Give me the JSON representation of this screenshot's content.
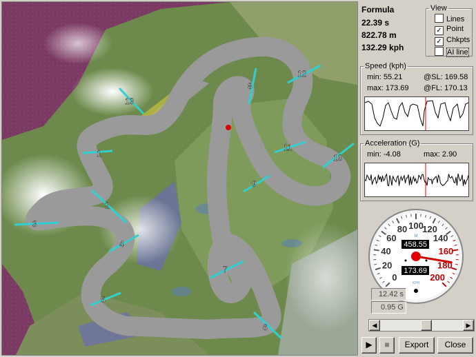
{
  "race": {
    "car": "Formula",
    "time": "22.39 s",
    "distance": "822.78 m",
    "speed": "132.29 kph"
  },
  "view": {
    "legend": "View",
    "options": [
      {
        "label": "Lines",
        "checked": false
      },
      {
        "label": "Point",
        "checked": true
      },
      {
        "label": "Chkpts",
        "checked": true
      },
      {
        "label": "AI line",
        "checked": false
      }
    ]
  },
  "speed_panel": {
    "legend": "Speed (kph)",
    "min_label": "min: 55.21",
    "max_label": "max: 173.69",
    "sl_label": "@SL: 169.58",
    "fl_label": "@FL: 170.13"
  },
  "accel_panel": {
    "legend": "Acceleration (G)",
    "min_label": "min: -4.08",
    "max_label": "max: 2.90"
  },
  "gauge": {
    "ticks": [
      "0",
      "20",
      "40",
      "60",
      "80",
      "100",
      "120",
      "140",
      "160",
      "180",
      "200"
    ],
    "odometer": "458.55",
    "speed": "173.69",
    "unit_top": "M",
    "unit_bottom": "KPH",
    "needle_value": 173.69,
    "max": 200
  },
  "readouts": {
    "lap_time": "12.42 s",
    "g_force": "0.95 G"
  },
  "scroll": {
    "position": 0.55
  },
  "buttons": {
    "play": "▶",
    "stop": "■",
    "export": "Export",
    "close": "Close"
  },
  "checkpoints": [
    "1",
    "2",
    "3",
    "4",
    "5",
    "6",
    "7",
    "8",
    "9",
    "10",
    "11",
    "12",
    "13"
  ]
}
